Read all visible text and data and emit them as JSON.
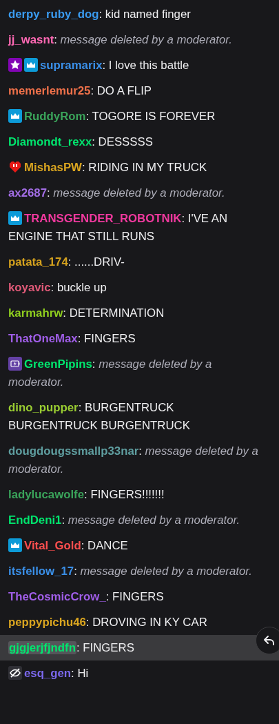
{
  "messages": [
    {
      "user": "derpy_ruby_dog",
      "color": "#3a9bf0",
      "separator": ":",
      "text": "kid named finger",
      "deleted": false,
      "selected": false
    },
    {
      "user": "jj_wasnt",
      "color": "#ff69b4",
      "separator": ":",
      "text": "message deleted by a moderator.",
      "deleted": true,
      "selected": false
    },
    {
      "user": "supramarix",
      "color": "#3a8fe8",
      "badges": [
        {
          "kind": "star"
        },
        {
          "kind": "crown"
        }
      ],
      "separator": ":",
      "text": "I love this battle",
      "deleted": false,
      "selected": false
    },
    {
      "user": "memerlemur25",
      "color": "#f0714a",
      "separator": ":",
      "text": "DO A FLIP",
      "deleted": false,
      "selected": false
    },
    {
      "user": "RuddyRom",
      "color": "#3aa35a",
      "badges": [
        {
          "kind": "crown"
        }
      ],
      "separator": ":",
      "text": "TOGORE IS FOREVER",
      "deleted": false,
      "selected": false
    },
    {
      "user": "Diamondt_rexx",
      "color": "#00e66e",
      "separator": ":",
      "text": "DESSSSS",
      "deleted": false,
      "selected": false
    },
    {
      "user": "MishasPW",
      "color": "#daa520",
      "badges": [
        {
          "kind": "heart"
        }
      ],
      "separator": ":",
      "text": "RIDING IN MY TRUCK",
      "deleted": false,
      "selected": false
    },
    {
      "user": "ax2687",
      "color": "#a36ee6",
      "separator": ":",
      "text": "message deleted by a moderator.",
      "deleted": true,
      "selected": false
    },
    {
      "user": "TRANSGENDER_ROBOTNIK",
      "color": "#f0399e",
      "badges": [
        {
          "kind": "crown"
        }
      ],
      "separator": ":",
      "text": "I'VE AN ENGINE THAT STILL RUNS",
      "deleted": false,
      "selected": false
    },
    {
      "user": "patata_174",
      "color": "#d4a11e",
      "separator": ":",
      "text": "......DRIV-",
      "deleted": false,
      "selected": false
    },
    {
      "user": "koyavic",
      "color": "#e05a78",
      "separator": ":",
      "text": "buckle up",
      "deleted": false,
      "selected": false
    },
    {
      "user": "karmahrw",
      "color": "#8fce1f",
      "separator": ":",
      "text": "DETERMINATION",
      "deleted": false,
      "selected": false
    },
    {
      "user": "ThatOneMax",
      "color": "#a05ee8",
      "separator": ":",
      "text": "FINGERS",
      "deleted": false,
      "selected": false
    },
    {
      "user": "GreenPipins",
      "color": "#00e66e",
      "badges": [
        {
          "kind": "bolt"
        }
      ],
      "separator": ":",
      "text": "message deleted by a moderator.",
      "deleted": true,
      "selected": false
    },
    {
      "user": "dino_pupper",
      "color": "#9acd32",
      "separator": ":",
      "text": "BURGENTRUCK BURGENTRUCK BURGENTRUCK",
      "deleted": false,
      "selected": false
    },
    {
      "user": "dougdougssmallp33nar",
      "color": "#5f9ea0",
      "separator": ":",
      "text": "message deleted by a moderator.",
      "deleted": true,
      "selected": false
    },
    {
      "user": "ladylucawolfe",
      "color": "#3aa35a",
      "separator": ":",
      "text": "FINGERS!!!!!!!",
      "deleted": false,
      "selected": false
    },
    {
      "user": "EndDeni1",
      "color": "#00e66e",
      "separator": ":",
      "text": "message deleted by a moderator.",
      "deleted": true,
      "selected": false
    },
    {
      "user": "Vital_Gold",
      "color": "#ff4f4f",
      "badges": [
        {
          "kind": "crown"
        }
      ],
      "separator": ":",
      "text": "DANCE",
      "deleted": false,
      "selected": false
    },
    {
      "user": "itsfellow_17",
      "color": "#3a8fe8",
      "separator": ":",
      "text": "message deleted by a moderator.",
      "deleted": true,
      "selected": false
    },
    {
      "user": "TheCosmicCrow_",
      "color": "#a05ee8",
      "separator": ":",
      "text": "FINGERS",
      "deleted": false,
      "selected": false
    },
    {
      "user": "peppypichu46",
      "color": "#daa520",
      "separator": ":",
      "text": "DROVING IN KY CAR",
      "deleted": false,
      "selected": false
    },
    {
      "user": "gjgjerjfjndfn",
      "color": "#00e66e",
      "separator": ":",
      "text": "FINGERS",
      "deleted": false,
      "selected": true
    },
    {
      "user": "esq_gen",
      "color": "#7b68ee",
      "badges": [
        {
          "kind": "hidden"
        }
      ],
      "separator": ":",
      "text": "Hi",
      "deleted": false,
      "selected": false
    }
  ]
}
